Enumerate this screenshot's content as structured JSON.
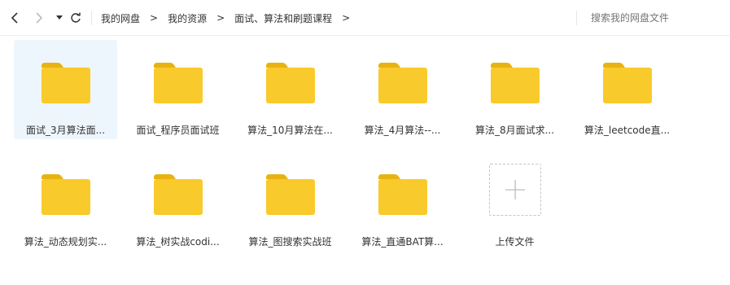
{
  "toolbar": {
    "breadcrumb": [
      "我的网盘",
      "我的资源",
      "面试、算法和刷题课程"
    ],
    "breadcrumb_separator": ">",
    "search_placeholder": "搜索我的网盘文件"
  },
  "folders": [
    {
      "name": "面试_3月算法面..."
    },
    {
      "name": "面试_程序员面试班"
    },
    {
      "name": "算法_10月算法在..."
    },
    {
      "name": "算法_4月算法--..."
    },
    {
      "name": "算法_8月面试求..."
    },
    {
      "name": "算法_leetcode直..."
    },
    {
      "name": "算法_动态规划实..."
    },
    {
      "name": "算法_树实战codi..."
    },
    {
      "name": "算法_图搜索实战班"
    },
    {
      "name": "算法_直通BAT算..."
    }
  ],
  "upload": {
    "label": "上传文件"
  },
  "colors": {
    "folder_body": "#f9ca2c",
    "folder_tab": "#e8b311",
    "selected_bg": "#eef6fd"
  }
}
